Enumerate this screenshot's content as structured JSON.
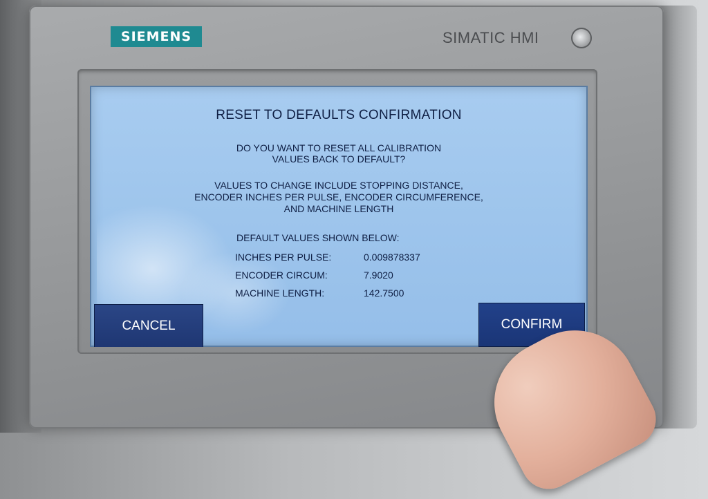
{
  "device": {
    "logo_text": "SIEMENS",
    "brand_text": "SIMATIC HMI"
  },
  "dialog": {
    "title": "RESET TO DEFAULTS CONFIRMATION",
    "question_line1": "DO YOU WANT TO RESET ALL CALIBRATION",
    "question_line2": "VALUES BACK TO DEFAULT?",
    "values_line1": "VALUES TO CHANGE INCLUDE STOPPING DISTANCE,",
    "values_line2": "ENCODER INCHES PER PULSE, ENCODER CIRCUMFERENCE,",
    "values_line3": "AND MACHINE LENGTH",
    "defaults_header": "DEFAULT VALUES SHOWN BELOW:",
    "defaults": [
      {
        "label": "INCHES PER PULSE:",
        "value": "0.009878337"
      },
      {
        "label": "ENCODER CIRCUM:",
        "value": "7.9020"
      },
      {
        "label": "MACHINE LENGTH:",
        "value": "142.7500"
      }
    ]
  },
  "buttons": {
    "cancel_label": "CANCEL",
    "confirm_label": "CONFIRM"
  },
  "colors": {
    "screen_bg": "#a8ccf0",
    "button_bg": "#1e3672",
    "logo_bg": "#1f8a91",
    "text": "#0f1f44"
  }
}
